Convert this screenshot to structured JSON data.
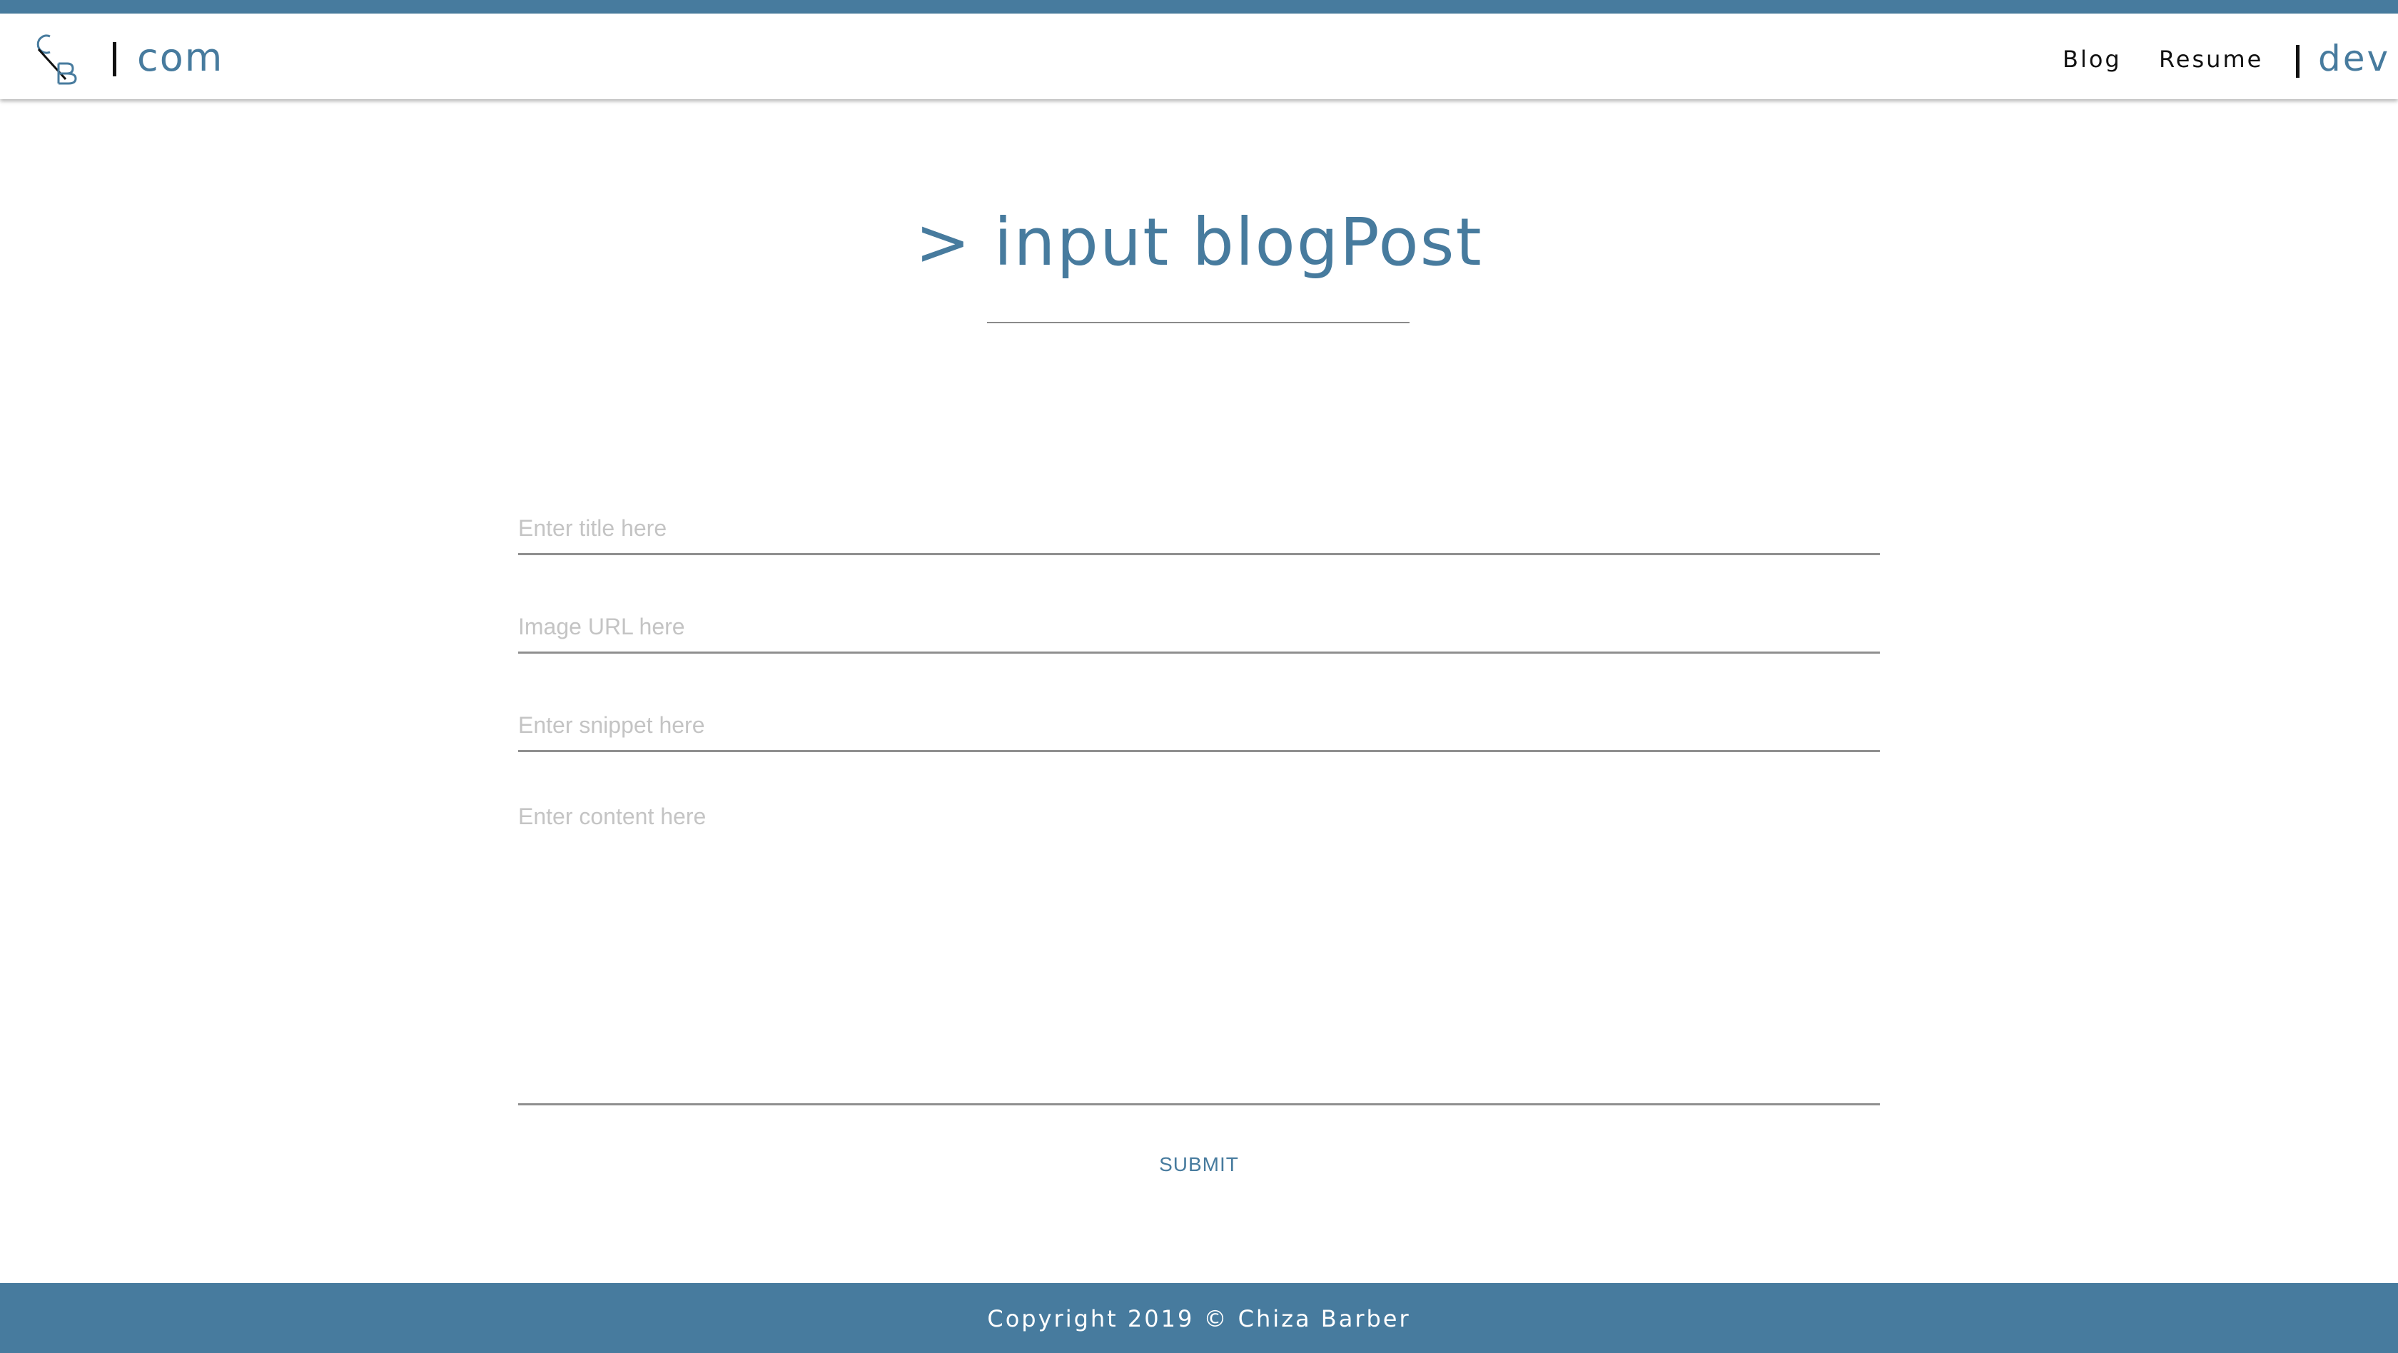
{
  "colors": {
    "accent": "#477b9e",
    "text": "#111111",
    "placeholder": "#c4c4c4",
    "divider": "#8f8f8f",
    "footer_text": "#ffffff"
  },
  "header": {
    "logo_icon": "cb-monogram-icon",
    "brand": "com",
    "nav": {
      "blog": "Blog",
      "resume": "Resume",
      "dev": "dev"
    }
  },
  "main": {
    "title": "> input blogPost",
    "form": {
      "title_placeholder": "Enter title here",
      "title_value": "",
      "image_placeholder": "Image URL here",
      "image_value": "",
      "snippet_placeholder": "Enter snippet here",
      "snippet_value": "",
      "content_placeholder": "Enter content here",
      "content_value": "",
      "submit_label": "SUBMIT"
    }
  },
  "footer": {
    "copyright": "Copyright 2019 © Chiza Barber"
  }
}
